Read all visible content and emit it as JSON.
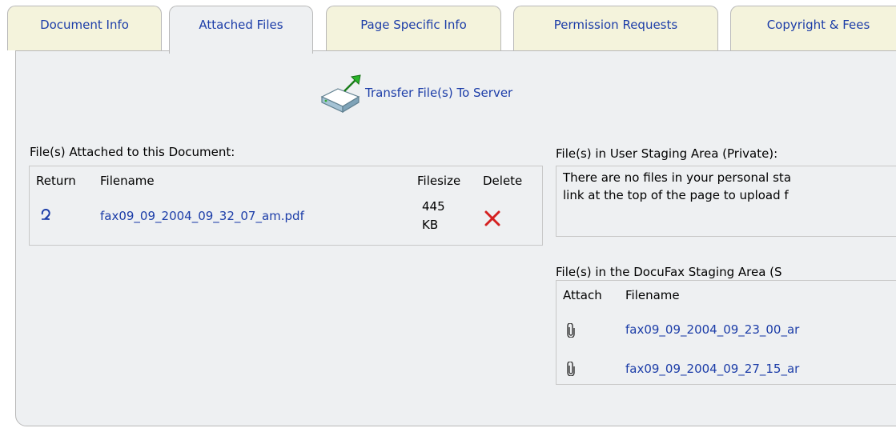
{
  "tabs": [
    {
      "label": "Document Info",
      "active": false
    },
    {
      "label": "Attached Files",
      "active": true
    },
    {
      "label": "Page Specific Info",
      "active": false
    },
    {
      "label": "Permission Requests",
      "active": false
    },
    {
      "label": "Copyright & Fees",
      "active": false
    }
  ],
  "transfer": {
    "label": "Transfer File(s) To Server",
    "icon": "upload-drive-icon"
  },
  "attached": {
    "title": "File(s) Attached to this Document:",
    "headers": {
      "return": "Return",
      "filename": "Filename",
      "filesize": "Filesize",
      "delete": "Delete"
    },
    "rows": [
      {
        "filename": "fax09_09_2004_09_32_07_am.pdf",
        "size_num": "445",
        "size_unit": "KB",
        "return_icon": "return-icon",
        "delete_icon": "delete-x-icon"
      }
    ]
  },
  "user_staging": {
    "title": "File(s) in User Staging Area (Private):",
    "message_line1": "There are no files in your personal sta",
    "message_line2": "link at the top of the page to upload f"
  },
  "docufax_staging": {
    "title": "File(s) in the DocuFax Staging Area (S",
    "headers": {
      "attach": "Attach",
      "filename": "Filename"
    },
    "rows": [
      {
        "filename": "fax09_09_2004_09_23_00_ar",
        "icon": "paperclip-icon"
      },
      {
        "filename": "fax09_09_2004_09_27_15_ar",
        "icon": "paperclip-icon"
      }
    ]
  },
  "colors": {
    "link": "#1c3da8",
    "tab_bg": "#f4f3dc",
    "panel_bg": "#eef0f2",
    "delete": "#d42020"
  }
}
